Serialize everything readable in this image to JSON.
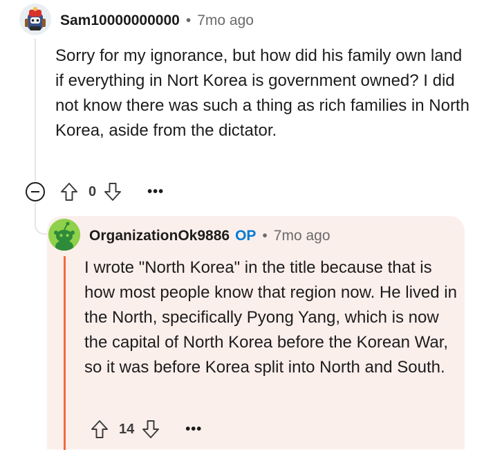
{
  "parent_comment": {
    "username": "Sam10000000000",
    "separator": "•",
    "age": "7mo ago",
    "body": "Sorry for my ignorance, but how did his family own land if everything in Nort Korea is government owned? I did not know there was such a thing as rich families in North Korea, aside from the dictator.",
    "vote_count": "0",
    "more_label": "•••",
    "avatar_icon": "snoo-avatar-icon"
  },
  "reply_comment": {
    "username": "OrganizationOk9886",
    "op_badge": "OP",
    "separator": "•",
    "age": "7mo ago",
    "body": "I wrote \"North Korea\" in the title because that is how most people know that region now. He lived in the North, specifically Pyong Yang, which is now the capital of North Korea before the Korean War, so it was before Korea split into North and South.",
    "vote_count": "14",
    "more_label": "•••",
    "avatar_icon": "snoo-avatar-icon"
  },
  "colors": {
    "highlight_bg": "#fbefec",
    "op_accent": "#f26a3b",
    "op_badge": "#0079d3",
    "thread_line": "#e5e5e5"
  }
}
